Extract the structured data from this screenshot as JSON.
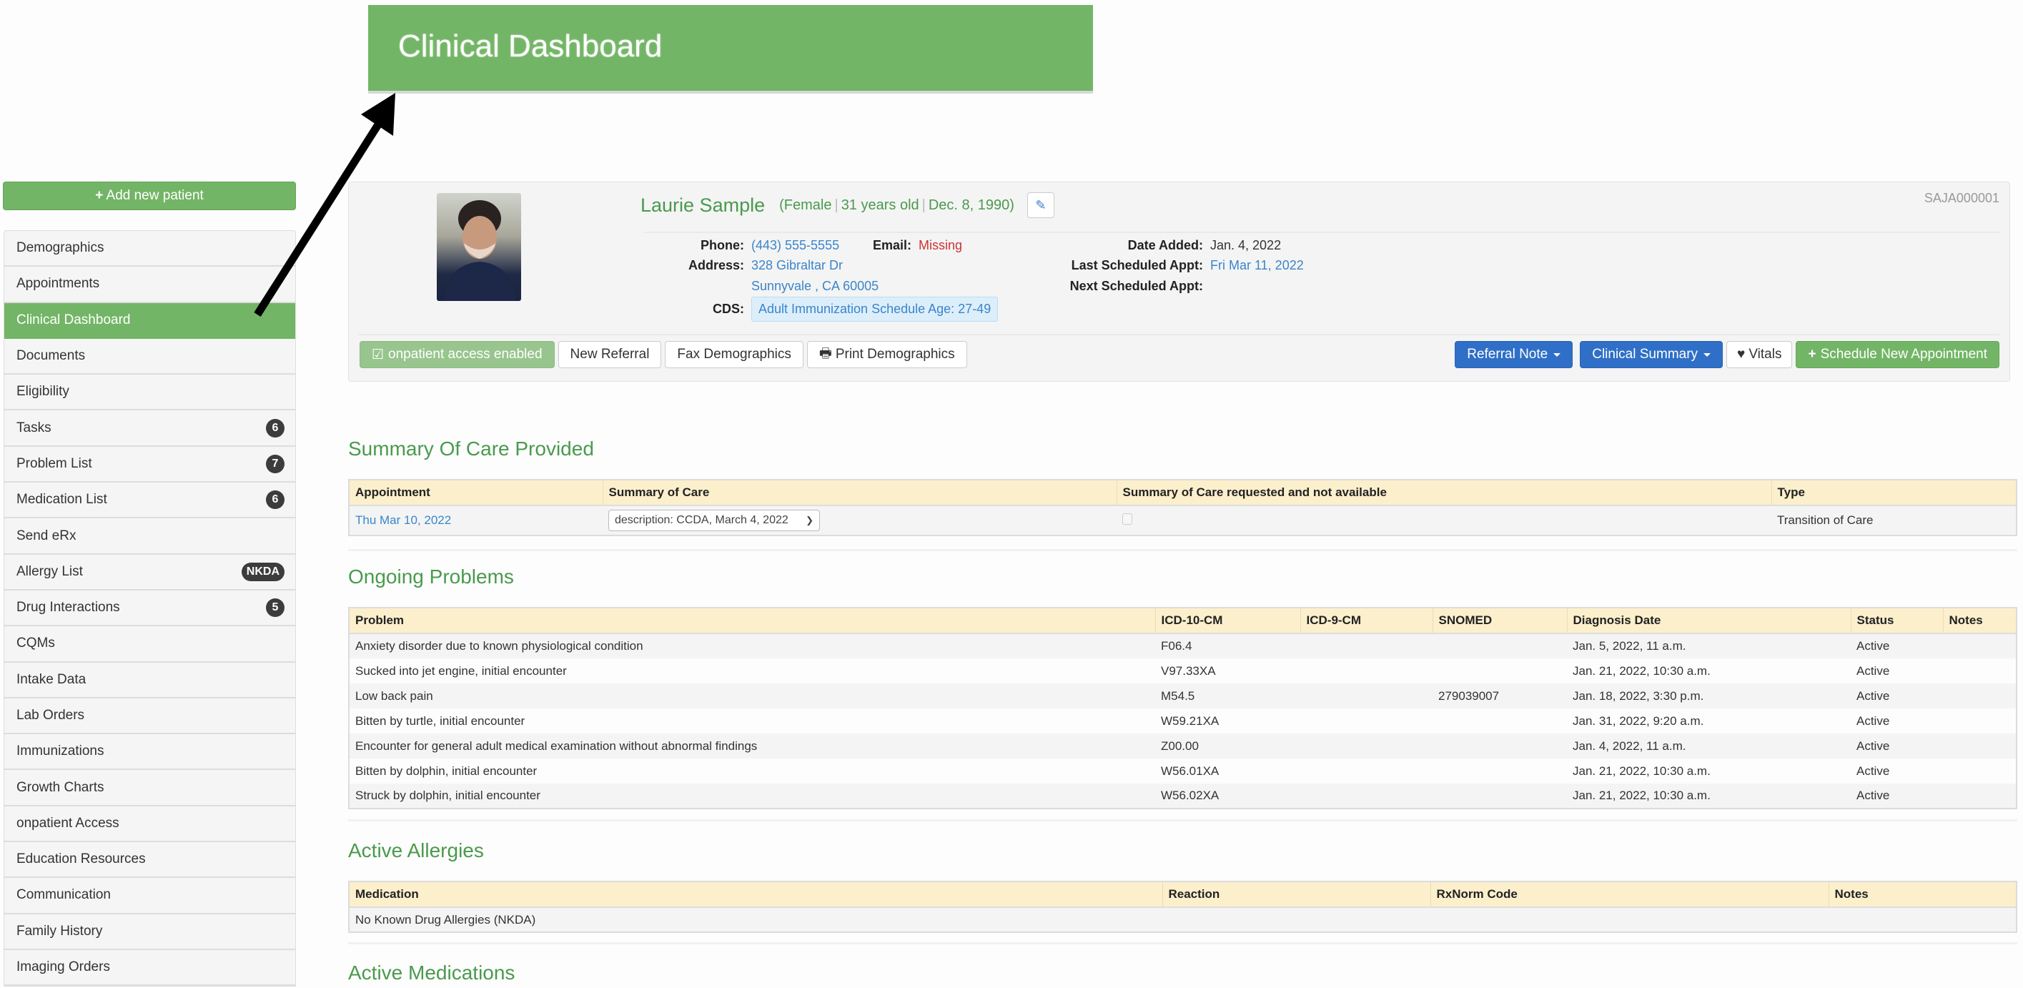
{
  "callout": {
    "title": "Clinical Dashboard"
  },
  "sidebar": {
    "add_patient_label": "Add new patient",
    "items": [
      {
        "label": "Demographics",
        "badge": null,
        "active": false
      },
      {
        "label": "Appointments",
        "badge": null,
        "active": false
      },
      {
        "label": "Clinical Dashboard",
        "badge": null,
        "active": true
      },
      {
        "label": "Documents",
        "badge": null,
        "active": false
      },
      {
        "label": "Eligibility",
        "badge": null,
        "active": false
      },
      {
        "label": "Tasks",
        "badge": "6",
        "active": false
      },
      {
        "label": "Problem List",
        "badge": "7",
        "active": false
      },
      {
        "label": "Medication List",
        "badge": "6",
        "active": false
      },
      {
        "label": "Send eRx",
        "badge": null,
        "active": false
      },
      {
        "label": "Allergy List",
        "badge": "NKDA",
        "active": false
      },
      {
        "label": "Drug Interactions",
        "badge": "5",
        "active": false
      },
      {
        "label": "CQMs",
        "badge": null,
        "active": false
      },
      {
        "label": "Intake Data",
        "badge": null,
        "active": false
      },
      {
        "label": "Lab Orders",
        "badge": null,
        "active": false
      },
      {
        "label": "Immunizations",
        "badge": null,
        "active": false
      },
      {
        "label": "Growth Charts",
        "badge": null,
        "active": false
      },
      {
        "label": "onpatient Access",
        "badge": null,
        "active": false
      },
      {
        "label": "Education Resources",
        "badge": null,
        "active": false
      },
      {
        "label": "Communication",
        "badge": null,
        "active": false
      },
      {
        "label": "Family History",
        "badge": null,
        "active": false
      },
      {
        "label": "Imaging Orders",
        "badge": null,
        "active": false
      }
    ]
  },
  "patient": {
    "id": "SAJA000001",
    "name": "Laurie Sample",
    "gender": "Female",
    "age": "31 years old",
    "dob": "Dec. 8, 1990",
    "phone_label": "Phone:",
    "phone": "(443) 555-5555",
    "email_label": "Email:",
    "email": "Missing",
    "address_label": "Address:",
    "address_line1": "328 Gibraltar Dr",
    "address_line2": "Sunnyvale , CA 60005",
    "cds_label": "CDS:",
    "cds": "Adult Immunization Schedule Age: 27-49",
    "date_added_label": "Date Added:",
    "date_added": "Jan. 4, 2022",
    "last_appt_label": "Last Scheduled Appt:",
    "last_appt": "Fri Mar 11, 2022",
    "next_appt_label": "Next Scheduled Appt:",
    "next_appt": ""
  },
  "actions": {
    "onpatient": "onpatient access enabled",
    "new_referral": "New Referral",
    "fax_demographics": "Fax Demographics",
    "print_demographics": "Print Demographics",
    "referral_note": "Referral Note",
    "clinical_summary": "Clinical Summary",
    "vitals": "Vitals",
    "schedule": "Schedule New Appointment"
  },
  "summary_of_care": {
    "title": "Summary Of Care Provided",
    "columns": [
      "Appointment",
      "Summary of Care",
      "Summary of Care requested and not available",
      "Type"
    ],
    "rows": [
      {
        "appointment": "Thu Mar 10, 2022",
        "summary_selected": "description: CCDA, March 4, 2022",
        "requested_not_available": false,
        "type": "Transition of Care"
      }
    ]
  },
  "ongoing_problems": {
    "title": "Ongoing Problems",
    "columns": [
      "Problem",
      "ICD-10-CM",
      "ICD-9-CM",
      "SNOMED",
      "Diagnosis Date",
      "Status",
      "Notes"
    ],
    "rows": [
      [
        "Anxiety disorder due to known physiological condition",
        "F06.4",
        "",
        "",
        "Jan. 5, 2022, 11 a.m.",
        "Active",
        ""
      ],
      [
        "Sucked into jet engine, initial encounter",
        "V97.33XA",
        "",
        "",
        "Jan. 21, 2022, 10:30 a.m.",
        "Active",
        ""
      ],
      [
        "Low back pain",
        "M54.5",
        "",
        "279039007",
        "Jan. 18, 2022, 3:30 p.m.",
        "Active",
        ""
      ],
      [
        "Bitten by turtle, initial encounter",
        "W59.21XA",
        "",
        "",
        "Jan. 31, 2022, 9:20 a.m.",
        "Active",
        ""
      ],
      [
        "Encounter for general adult medical examination without abnormal findings",
        "Z00.00",
        "",
        "",
        "Jan. 4, 2022, 11 a.m.",
        "Active",
        ""
      ],
      [
        "Bitten by dolphin, initial encounter",
        "W56.01XA",
        "",
        "",
        "Jan. 21, 2022, 10:30 a.m.",
        "Active",
        ""
      ],
      [
        "Struck by dolphin, initial encounter",
        "W56.02XA",
        "",
        "",
        "Jan. 21, 2022, 10:30 a.m.",
        "Active",
        ""
      ]
    ]
  },
  "active_allergies": {
    "title": "Active Allergies",
    "columns": [
      "Medication",
      "Reaction",
      "RxNorm Code",
      "Notes"
    ],
    "rows": [
      [
        "No Known Drug Allergies (NKDA)",
        "",
        "",
        ""
      ]
    ]
  },
  "active_medications": {
    "title": "Active Medications"
  }
}
